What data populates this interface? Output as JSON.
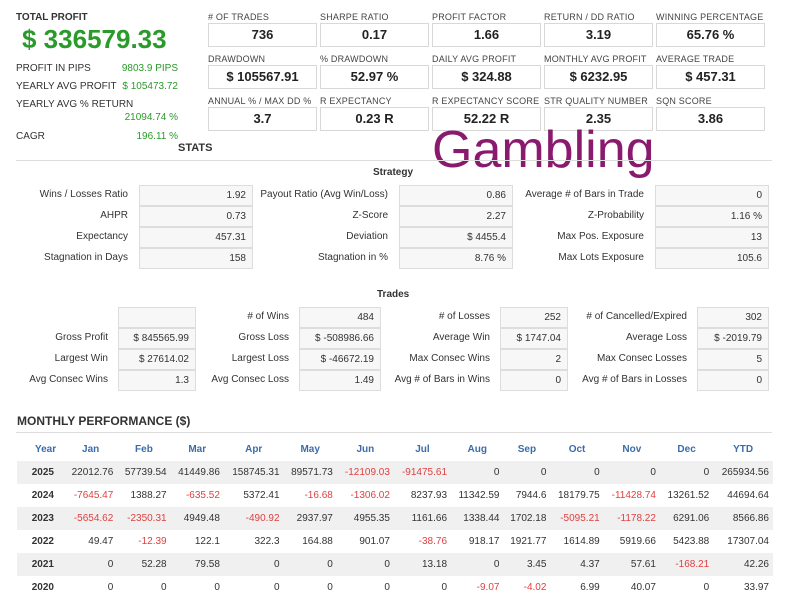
{
  "summary": {
    "total_profit_label": "TOTAL PROFIT",
    "total_profit_value": "$ 336579.33",
    "rows": [
      {
        "label": "PROFIT IN PIPS",
        "value": "9803.9 PIPS"
      },
      {
        "label": "YEARLY AVG PROFIT",
        "value": "$ 105473.72"
      },
      {
        "label": "YEARLY AVG % RETURN",
        "value": "21094.74 %"
      },
      {
        "label": "CAGR",
        "value": "196.11 %"
      }
    ]
  },
  "metrics": [
    {
      "label": "# OF TRADES",
      "value": "736"
    },
    {
      "label": "SHARPE RATIO",
      "value": "0.17"
    },
    {
      "label": "PROFIT FACTOR",
      "value": "1.66"
    },
    {
      "label": "RETURN / DD RATIO",
      "value": "3.19"
    },
    {
      "label": "WINNING PERCENTAGE",
      "value": "65.76 %"
    },
    {
      "label": "DRAWDOWN",
      "value": "$ 105567.91"
    },
    {
      "label": "% DRAWDOWN",
      "value": "52.97 %"
    },
    {
      "label": "DAILY AVG PROFIT",
      "value": "$ 324.88"
    },
    {
      "label": "MONTHLY AVG PROFIT",
      "value": "$ 6232.95"
    },
    {
      "label": "AVERAGE TRADE",
      "value": "$ 457.31"
    },
    {
      "label": "ANNUAL % / MAX DD %",
      "value": "3.7"
    },
    {
      "label": "R EXPECTANCY",
      "value": "0.23 R"
    },
    {
      "label": "R EXPECTANCY SCORE",
      "value": "52.22 R"
    },
    {
      "label": "STR QUALITY NUMBER",
      "value": "2.35"
    },
    {
      "label": "SQN SCORE",
      "value": "3.86"
    }
  ],
  "overlay_text": "Gambling",
  "stats_title": "STATS",
  "strategy": {
    "title": "Strategy",
    "rows": [
      [
        [
          "Wins / Losses Ratio",
          "1.92"
        ],
        [
          "Payout Ratio (Avg Win/Loss)",
          "0.86"
        ],
        [
          "Average # of Bars in Trade",
          "0"
        ]
      ],
      [
        [
          "AHPR",
          "0.73"
        ],
        [
          "Z-Score",
          "2.27"
        ],
        [
          "Z-Probability",
          "1.16 %"
        ]
      ],
      [
        [
          "Expectancy",
          "457.31"
        ],
        [
          "Deviation",
          "$ 4455.4"
        ],
        [
          "Max Pos. Exposure",
          "13"
        ]
      ],
      [
        [
          "Stagnation in Days",
          "158"
        ],
        [
          "Stagnation in %",
          "8.76 %"
        ],
        [
          "Max Lots Exposure",
          "105.6"
        ]
      ]
    ]
  },
  "trades": {
    "title": "Trades",
    "rows": [
      [
        [
          "",
          ""
        ],
        [
          "# of Wins",
          "484"
        ],
        [
          "# of Losses",
          "252"
        ],
        [
          "# of Cancelled/Expired",
          "302"
        ]
      ],
      [
        [
          "Gross Profit",
          "$ 845565.99"
        ],
        [
          "Gross Loss",
          "$ -508986.66"
        ],
        [
          "Average Win",
          "$ 1747.04"
        ],
        [
          "Average Loss",
          "$ -2019.79"
        ]
      ],
      [
        [
          "Largest Win",
          "$ 27614.02"
        ],
        [
          "Largest Loss",
          "$ -46672.19"
        ],
        [
          "Max Consec Wins",
          "2"
        ],
        [
          "Max Consec Losses",
          "5"
        ]
      ],
      [
        [
          "Avg Consec Wins",
          "1.3"
        ],
        [
          "Avg Consec Loss",
          "1.49"
        ],
        [
          "Avg # of Bars in Wins",
          "0"
        ],
        [
          "Avg # of Bars in Losses",
          "0"
        ]
      ]
    ]
  },
  "monthly": {
    "title": "MONTHLY PERFORMANCE ($)",
    "headers": [
      "Year",
      "Jan",
      "Feb",
      "Mar",
      "Apr",
      "May",
      "Jun",
      "Jul",
      "Aug",
      "Sep",
      "Oct",
      "Nov",
      "Dec",
      "YTD"
    ],
    "rows": [
      [
        "2025",
        "22012.76",
        "57739.54",
        "41449.86",
        "158745.31",
        "89571.73",
        "-12109.03",
        "-91475.61",
        "0",
        "0",
        "0",
        "0",
        "0",
        "265934.56"
      ],
      [
        "2024",
        "-7645.47",
        "1388.27",
        "-635.52",
        "5372.41",
        "-16.68",
        "-1306.02",
        "8237.93",
        "11342.59",
        "7944.6",
        "18179.75",
        "-11428.74",
        "13261.52",
        "44694.64"
      ],
      [
        "2023",
        "-5654.62",
        "-2350.31",
        "4949.48",
        "-490.92",
        "2937.97",
        "4955.35",
        "1161.66",
        "1338.44",
        "1702.18",
        "-5095.21",
        "-1178.22",
        "6291.06",
        "8566.86"
      ],
      [
        "2022",
        "49.47",
        "-12.39",
        "122.1",
        "322.3",
        "164.88",
        "901.07",
        "-38.76",
        "918.17",
        "1921.77",
        "1614.89",
        "5919.66",
        "5423.88",
        "17307.04"
      ],
      [
        "2021",
        "0",
        "52.28",
        "79.58",
        "0",
        "0",
        "0",
        "13.18",
        "0",
        "3.45",
        "4.37",
        "57.61",
        "-168.21",
        "42.26"
      ],
      [
        "2020",
        "0",
        "0",
        "0",
        "0",
        "0",
        "0",
        "0",
        "-9.07",
        "-4.02",
        "6.99",
        "40.07",
        "0",
        "33.97"
      ]
    ]
  },
  "colors": {
    "profit_green": "#2a9a2a",
    "negative_red": "#e04040",
    "header_blue": "#3a6da8",
    "overlay_purple": "#8a1a6e"
  }
}
